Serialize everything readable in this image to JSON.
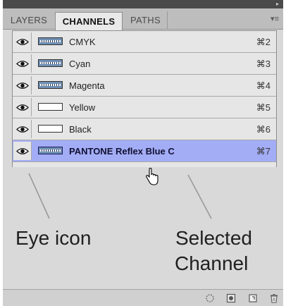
{
  "panel": {
    "tabs": [
      {
        "label": "LAYERS",
        "active": false
      },
      {
        "label": "CHANNELS",
        "active": true
      },
      {
        "label": "PATHS",
        "active": false
      }
    ],
    "channels": [
      {
        "name": "CMYK",
        "shortcut": "⌘2",
        "visible": true,
        "selected": false
      },
      {
        "name": "Cyan",
        "shortcut": "⌘3",
        "visible": true,
        "selected": false
      },
      {
        "name": "Magenta",
        "shortcut": "⌘4",
        "visible": true,
        "selected": false
      },
      {
        "name": "Yellow",
        "shortcut": "⌘5",
        "visible": true,
        "selected": false
      },
      {
        "name": "Black",
        "shortcut": "⌘6",
        "visible": true,
        "selected": false
      },
      {
        "name": "PANTONE Reflex Blue C",
        "shortcut": "⌘7",
        "visible": true,
        "selected": true
      }
    ],
    "colors": {
      "selected_row": "#a3adf5",
      "panel_bg": "#d9d9d9",
      "list_bg": "#e6e6e6"
    },
    "footer_icons": [
      "load-selection-icon",
      "save-selection-icon",
      "new-channel-icon",
      "trash-icon"
    ]
  },
  "annotations": {
    "eye_label": "Eye icon",
    "selected_label_line1": "Selected",
    "selected_label_line2": "Channel"
  }
}
